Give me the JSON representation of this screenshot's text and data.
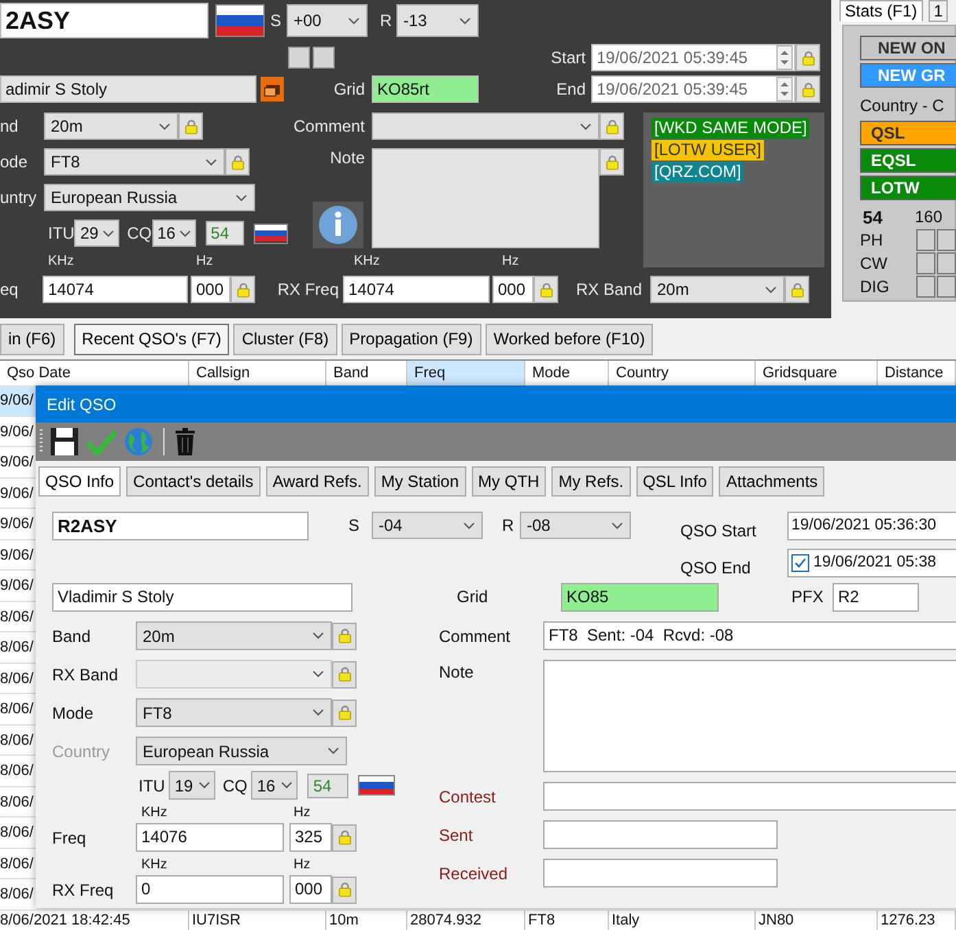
{
  "main_form": {
    "callsign": "2ASY",
    "s_label": "S",
    "s_report": "+00",
    "r_label": "R",
    "r_report": "-13",
    "start_label": "Start",
    "start": "19/06/2021 05:39:45",
    "end_label": "End",
    "end": "19/06/2021 05:39:45",
    "name": "adimir S Stoly",
    "grid_label": "Grid",
    "grid": "KO85rt",
    "band_label": "nd",
    "band": "20m",
    "comment_label": "Comment",
    "mode_label": "ode",
    "mode": "FT8",
    "note_label": "Note",
    "country_label": "untry",
    "country": "European Russia",
    "itu_label": "ITU",
    "itu": "29",
    "cq_label": "CQ",
    "cq": "16",
    "zone": "54",
    "freq_khz_unit": "KHz",
    "freq_hz_unit": "Hz",
    "rx_khz_unit": "KHz",
    "rx_hz_unit": "Hz",
    "freq_label": "eq",
    "freq_khz": "14074",
    "freq_hz": "000",
    "rx_freq_label": "RX Freq",
    "rx_freq_khz": "14074",
    "rx_freq_hz": "000",
    "rx_band_label": "RX Band",
    "rx_band": "20m",
    "tags": [
      {
        "text": "[WKD SAME MODE]",
        "color": "#0a8a0a"
      },
      {
        "text": "[LOTW USER]",
        "color": "#f5c400"
      },
      {
        "text": "[QRZ.COM]",
        "color": "#11858f"
      }
    ]
  },
  "stats_panel": {
    "tabs": [
      {
        "label": "Stats (F1)",
        "selected": true
      },
      {
        "label": "1",
        "selected": false
      }
    ],
    "badges": [
      {
        "text": "NEW ON",
        "color": "#c8c8c8"
      },
      {
        "text": "NEW GR",
        "color": "#3399ff"
      }
    ],
    "country_text": "Country - C",
    "qsl_badges": [
      {
        "text": "QSL",
        "color": "#ffa500"
      },
      {
        "text": "EQSL",
        "color": "#0a8a0a"
      },
      {
        "text": "LOTW",
        "color": "#0a8a0a"
      }
    ],
    "count": "54",
    "band_header": "160",
    "mode_rows": [
      "PH",
      "CW",
      "DIG"
    ]
  },
  "view_tabs": [
    {
      "label": "in (F6)",
      "selected": false
    },
    {
      "label": "Recent QSO's (F7)",
      "selected": true
    },
    {
      "label": "Cluster (F8)",
      "selected": false
    },
    {
      "label": "Propagation (F9)",
      "selected": false
    },
    {
      "label": "Worked before (F10)",
      "selected": false
    }
  ],
  "log_table": {
    "columns": [
      {
        "label": "Qso Date",
        "selected": false
      },
      {
        "label": "Callsign",
        "selected": false
      },
      {
        "label": "Band",
        "selected": false
      },
      {
        "label": "Freq",
        "selected": true
      },
      {
        "label": "Mode",
        "selected": false
      },
      {
        "label": "Country",
        "selected": false
      },
      {
        "label": "Gridsquare",
        "selected": false
      },
      {
        "label": "Distance",
        "selected": false
      }
    ],
    "rows": [
      {
        "cells": [
          "9/06/"
        ],
        "selected": true
      },
      {
        "cells": [
          "9/06/"
        ],
        "selected": false
      },
      {
        "cells": [
          "9/06/"
        ],
        "selected": false
      },
      {
        "cells": [
          "9/06/"
        ],
        "selected": false
      },
      {
        "cells": [
          "9/06/"
        ],
        "selected": false
      },
      {
        "cells": [
          "9/06/"
        ],
        "selected": false
      },
      {
        "cells": [
          "9/06/"
        ],
        "selected": false
      },
      {
        "cells": [
          "8/06/"
        ],
        "selected": false
      },
      {
        "cells": [
          "8/06/"
        ],
        "selected": false
      },
      {
        "cells": [
          "8/06/"
        ],
        "selected": false
      },
      {
        "cells": [
          "8/06/"
        ],
        "selected": false
      },
      {
        "cells": [
          "8/06/"
        ],
        "selected": false
      },
      {
        "cells": [
          "8/06/"
        ],
        "selected": false
      },
      {
        "cells": [
          "8/06/"
        ],
        "selected": false
      },
      {
        "cells": [
          "8/06/"
        ],
        "selected": false
      },
      {
        "cells": [
          "8/06/"
        ],
        "selected": false
      },
      {
        "cells": [
          "8/06/"
        ],
        "selected": false
      },
      {
        "cells": [
          "8/06/2021 18:42:45",
          "IU7ISR",
          "10m",
          "28074.932",
          "FT8",
          "Italy",
          "JN80",
          "1276.23"
        ],
        "selected": false
      }
    ]
  },
  "edit_dialog": {
    "title": "Edit QSO",
    "tabs": [
      {
        "label": "QSO Info",
        "selected": true
      },
      {
        "label": "Contact's details",
        "selected": false
      },
      {
        "label": "Award Refs.",
        "selected": false
      },
      {
        "label": "My Station",
        "selected": false
      },
      {
        "label": "My QTH",
        "selected": false
      },
      {
        "label": "My Refs.",
        "selected": false
      },
      {
        "label": "QSL Info",
        "selected": false
      },
      {
        "label": "Attachments",
        "selected": false
      }
    ],
    "callsign": "R2ASY",
    "s_label": "S",
    "s_report": "-04",
    "r_label": "R",
    "r_report": "-08",
    "start_label": "QSO Start",
    "start": "19/06/2021 05:36:30",
    "end_label": "QSO End",
    "end_checked": true,
    "end": "19/06/2021 05:38",
    "name": "Vladimir S Stoly",
    "grid_label": "Grid",
    "grid": "KO85",
    "pfx_label": "PFX",
    "pfx": "R2",
    "band_label": "Band",
    "band": "20m",
    "comment_label": "Comment",
    "comment": "FT8  Sent: -04  Rcvd: -08",
    "rx_band_label": "RX Band",
    "rx_band_disabled": true,
    "note_label": "Note",
    "mode_label": "Mode",
    "mode": "FT8",
    "country_label": "Country",
    "country_label_disabled": true,
    "country": "European Russia",
    "itu_label": "ITU",
    "itu": "19",
    "cq_label": "CQ",
    "cq": "16",
    "zone": "54",
    "contest_label": "Contest",
    "sent_label": "Sent",
    "received_label": "Received",
    "freq_khz_unit": "KHz",
    "freq_hz_unit": "Hz",
    "freq_label": "Freq",
    "freq_khz": "14076",
    "freq_hz": "325",
    "rx_khz_unit": "KHz",
    "rx_hz_unit": "Hz",
    "rx_freq_label": "RX Freq",
    "rx_freq_khz": "0",
    "rx_freq_hz": "000"
  }
}
